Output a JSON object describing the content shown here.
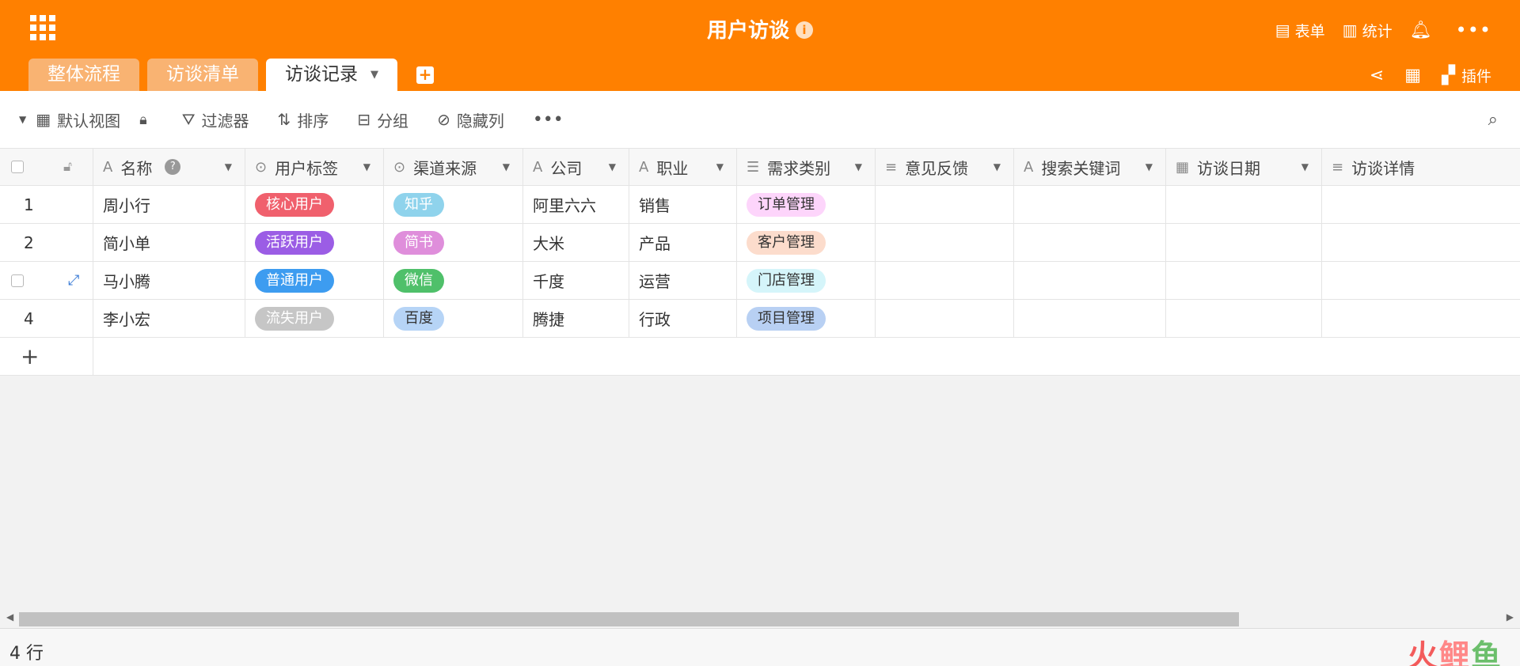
{
  "app": {
    "title": "用户访谈",
    "header_actions": [
      {
        "icon": "form-icon",
        "label": "表单"
      },
      {
        "icon": "stats-icon",
        "label": "统计"
      }
    ],
    "plugin_label": "插件"
  },
  "tabs": [
    {
      "label": "整体流程",
      "active": false
    },
    {
      "label": "访谈清单",
      "active": false
    },
    {
      "label": "访谈记录",
      "active": true
    }
  ],
  "toolbar": {
    "view_label": "默认视图",
    "filter_label": "过滤器",
    "sort_label": "排序",
    "group_label": "分组",
    "hide_label": "隐藏列"
  },
  "columns": [
    "名称",
    "用户标签",
    "渠道来源",
    "公司",
    "职业",
    "需求类别",
    "意见反馈",
    "搜索关键词",
    "访谈日期",
    "访谈详情"
  ],
  "rows": [
    {
      "num": "1",
      "name": "周小行",
      "user_tag": "核心用户",
      "channel": "知乎",
      "company": "阿里六六",
      "job": "销售",
      "need": "订单管理"
    },
    {
      "num": "2",
      "name": "简小单",
      "user_tag": "活跃用户",
      "channel": "简书",
      "company": "大米",
      "job": "产品",
      "need": "客户管理"
    },
    {
      "num": "",
      "name": "马小腾",
      "user_tag": "普通用户",
      "channel": "微信",
      "company": "千度",
      "job": "运营",
      "need": "门店管理"
    },
    {
      "num": "4",
      "name": "李小宏",
      "user_tag": "流失用户",
      "channel": "百度",
      "company": "腾捷",
      "job": "行政",
      "need": "项目管理"
    }
  ],
  "tag_colors": {
    "核心用户": {
      "bg": "#f0606d",
      "fg": "#ffffff"
    },
    "活跃用户": {
      "bg": "#9b5de5",
      "fg": "#ffffff"
    },
    "普通用户": {
      "bg": "#3d9cf0",
      "fg": "#ffffff"
    },
    "流失用户": {
      "bg": "#c6c6c6",
      "fg": "#ffffff"
    },
    "知乎": {
      "bg": "#8fd3ec",
      "fg": "#ffffff"
    },
    "简书": {
      "bg": "#df8edb",
      "fg": "#ffffff"
    },
    "微信": {
      "bg": "#4fc06a",
      "fg": "#ffffff"
    },
    "百度": {
      "bg": "#b6d4f6",
      "fg": "#333333"
    },
    "订单管理": {
      "bg": "#fdd5fb",
      "fg": "#333333"
    },
    "客户管理": {
      "bg": "#fcdccc",
      "fg": "#333333"
    },
    "门店管理": {
      "bg": "#d5f5fa",
      "fg": "#333333"
    },
    "项目管理": {
      "bg": "#b8d0f3",
      "fg": "#333333"
    }
  },
  "footer": {
    "row_count": "4 行",
    "watermark": [
      "火",
      "鲤",
      "鱼"
    ]
  },
  "colors": {
    "brand": "#ff8000"
  }
}
